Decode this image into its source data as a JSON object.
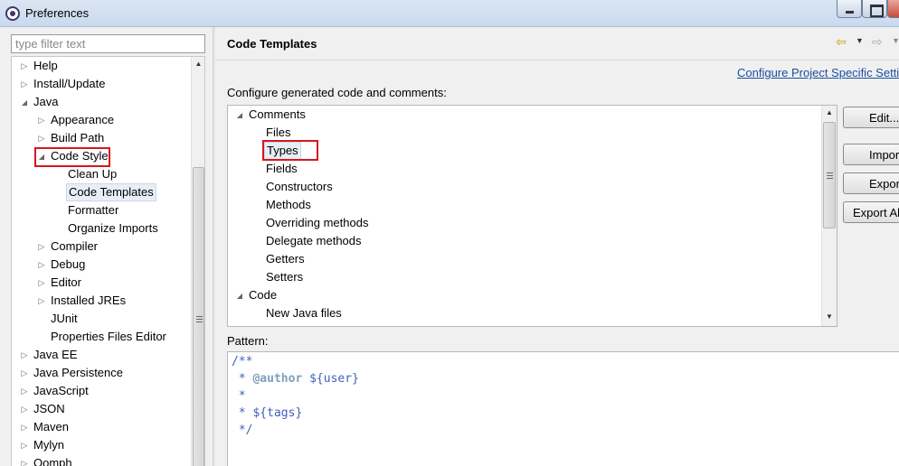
{
  "window": {
    "title": "Preferences"
  },
  "filter": {
    "placeholder": "type filter text"
  },
  "left_tree": {
    "items": [
      {
        "label": "Help",
        "depth": 0,
        "state": "collapsed"
      },
      {
        "label": "Install/Update",
        "depth": 0,
        "state": "collapsed"
      },
      {
        "label": "Java",
        "depth": 0,
        "state": "expanded"
      },
      {
        "label": "Appearance",
        "depth": 1,
        "state": "collapsed"
      },
      {
        "label": "Build Path",
        "depth": 1,
        "state": "collapsed"
      },
      {
        "label": "Code Style",
        "depth": 1,
        "state": "expanded"
      },
      {
        "label": "Clean Up",
        "depth": 2,
        "state": "leaf"
      },
      {
        "label": "Code Templates",
        "depth": 2,
        "state": "leaf",
        "selected": true
      },
      {
        "label": "Formatter",
        "depth": 2,
        "state": "leaf"
      },
      {
        "label": "Organize Imports",
        "depth": 2,
        "state": "leaf"
      },
      {
        "label": "Compiler",
        "depth": 1,
        "state": "collapsed"
      },
      {
        "label": "Debug",
        "depth": 1,
        "state": "collapsed"
      },
      {
        "label": "Editor",
        "depth": 1,
        "state": "collapsed"
      },
      {
        "label": "Installed JREs",
        "depth": 1,
        "state": "collapsed"
      },
      {
        "label": "JUnit",
        "depth": 1,
        "state": "leaf"
      },
      {
        "label": "Properties Files Editor",
        "depth": 1,
        "state": "leaf"
      },
      {
        "label": "Java EE",
        "depth": 0,
        "state": "collapsed"
      },
      {
        "label": "Java Persistence",
        "depth": 0,
        "state": "collapsed"
      },
      {
        "label": "JavaScript",
        "depth": 0,
        "state": "collapsed"
      },
      {
        "label": "JSON",
        "depth": 0,
        "state": "collapsed"
      },
      {
        "label": "Maven",
        "depth": 0,
        "state": "collapsed"
      },
      {
        "label": "Mylyn",
        "depth": 0,
        "state": "collapsed"
      },
      {
        "label": "Oomph",
        "depth": 0,
        "state": "collapsed"
      }
    ]
  },
  "page": {
    "title": "Code Templates",
    "config_link": "Configure Project Specific Setti",
    "description": "Configure generated code and comments:",
    "pattern_label": "Pattern:"
  },
  "templates_tree": {
    "items": [
      {
        "label": "Comments",
        "depth": 0,
        "state": "expanded"
      },
      {
        "label": "Files",
        "depth": 1,
        "state": "leaf"
      },
      {
        "label": "Types",
        "depth": 1,
        "state": "leaf",
        "selected": true
      },
      {
        "label": "Fields",
        "depth": 1,
        "state": "leaf"
      },
      {
        "label": "Constructors",
        "depth": 1,
        "state": "leaf"
      },
      {
        "label": "Methods",
        "depth": 1,
        "state": "leaf"
      },
      {
        "label": "Overriding methods",
        "depth": 1,
        "state": "leaf"
      },
      {
        "label": "Delegate methods",
        "depth": 1,
        "state": "leaf"
      },
      {
        "label": "Getters",
        "depth": 1,
        "state": "leaf"
      },
      {
        "label": "Setters",
        "depth": 1,
        "state": "leaf"
      },
      {
        "label": "Code",
        "depth": 0,
        "state": "expanded"
      },
      {
        "label": "New Java files",
        "depth": 1,
        "state": "leaf"
      }
    ]
  },
  "buttons": {
    "edit": "Edit...",
    "import": "Import...",
    "export": "Export...",
    "export_all": "Export All..."
  },
  "pattern": {
    "line1": "/**",
    "line2_prefix": " * ",
    "line2_tag": "@author",
    "line2_rest": " ${user}",
    "line3": " *",
    "line4": " * ${tags}",
    "line5": " */"
  },
  "colors": {
    "highlight": "#d7161d",
    "link": "#1a4fa0",
    "comment": "#3f5fbf",
    "javadoc_tag": "#7f9fbf"
  }
}
